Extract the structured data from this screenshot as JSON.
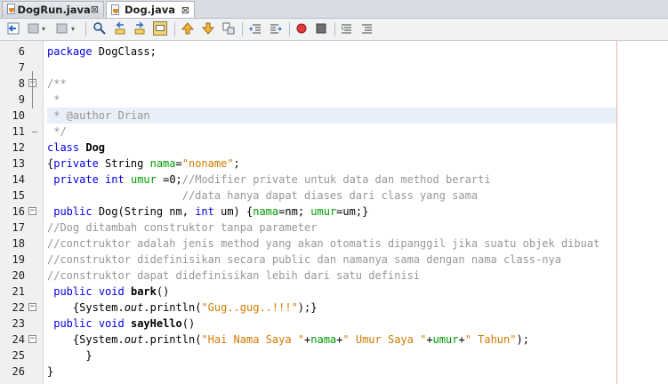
{
  "tabs": [
    {
      "label": "DogRun.java",
      "active": false
    },
    {
      "label": "Dog.java",
      "active": true
    }
  ],
  "toolbar": {
    "buttons": [
      "back-icon",
      "source-icon",
      "forward-icon",
      "find-icon",
      "find-previous-icon",
      "find-next-icon",
      "toggle-highlight-icon",
      "previous-bookmark-icon",
      "next-bookmark-icon",
      "toggle-bookmark-icon",
      "shift-left-icon",
      "shift-right-icon",
      "start-macro-icon",
      "stop-macro-icon",
      "comment-icon",
      "uncomment-icon"
    ]
  },
  "editor": {
    "highlighted_line": 10,
    "lines": [
      {
        "n": "6",
        "code": "package DogClass;"
      },
      {
        "n": "7",
        "code": ""
      },
      {
        "n": "8",
        "code": "/**"
      },
      {
        "n": "9",
        "code": " *"
      },
      {
        "n": "10",
        "code": " * @author Drian"
      },
      {
        "n": "11",
        "code": " */"
      },
      {
        "n": "12",
        "code": "class Dog"
      },
      {
        "n": "13",
        "code": "{private String nama=\"noname\";"
      },
      {
        "n": "14",
        "code": " private int umur =0;//Modifier private untuk data dan method berarti"
      },
      {
        "n": "15",
        "code": "                     //data hanya dapat diases dari class yang sama"
      },
      {
        "n": "16",
        "code": " public Dog(String nm, int um) {nama=nm; umur=um;}"
      },
      {
        "n": "17",
        "code": "//Dog ditambah construktor tanpa parameter"
      },
      {
        "n": "18",
        "code": "//conctruktor adalah jenis method yang akan otomatis dipanggil jika suatu objek dibuat"
      },
      {
        "n": "19",
        "code": "//construktor didefinisikan secara public dan namanya sama dengan nama class-nya"
      },
      {
        "n": "20",
        "code": "//construktor dapat didefinisikan lebih dari satu definisi"
      },
      {
        "n": "21",
        "code": " public void bark()"
      },
      {
        "n": "22",
        "code": "    {System.out.println(\"Gug..gug..!!!\");}"
      },
      {
        "n": "23",
        "code": " public void sayHello()"
      },
      {
        "n": "24",
        "code": "    {System.out.println(\"Hai Nama Saya \"+nama+\" Umur Saya \"+umur+\" Tahun\");"
      },
      {
        "n": "25",
        "code": "      }"
      },
      {
        "n": "26",
        "code": "}"
      }
    ]
  }
}
